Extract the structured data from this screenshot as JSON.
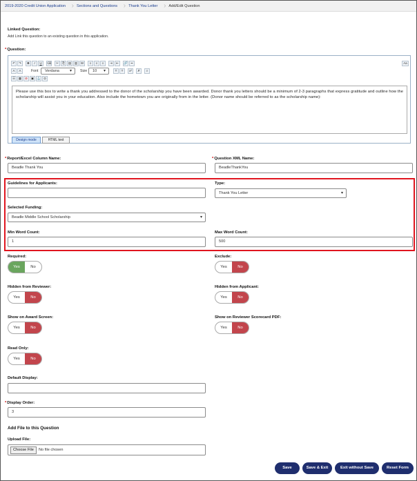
{
  "breadcrumb": [
    "2019-2020 Credit Union Application",
    "Sections and Questions",
    "Thank You Letter",
    "Add/Edit Question"
  ],
  "linked_question": {
    "label": "Linked Question:",
    "help": "Add Link this question to an existing question in this application."
  },
  "question": {
    "label": "Question:",
    "font_label": "Font",
    "font_value": "Verdana",
    "size_label": "Size",
    "size_value": "10",
    "aa_label": "Aa",
    "text": "Please use this box to write a thank you addressed to the donor of the scholarship you have been awarded. Donor thank you letters should be a minimum of 2-3 paragraphs that express gratitude and outline how the scholarship will assist you in your education. Also include the hometown you are originally from in the letter. (Donor name should be referred to as the scholarship name):",
    "design_mode": "Design mode",
    "html_text": "HTML text"
  },
  "toolbar_icons": [
    "undo-icon",
    "redo-icon",
    "bold-icon",
    "italic-icon",
    "underline-icon",
    "eraser-icon",
    "cut-icon",
    "copy-icon",
    "paste-icon",
    "paste-text-icon",
    "paste-word-icon",
    "align-left-icon",
    "align-center-icon",
    "align-right-icon",
    "indent-icon",
    "outdent-icon",
    "link-icon",
    "rule-icon"
  ],
  "report_column": {
    "label": "Report/Excel Column Name:",
    "value": "Beadle Thank You"
  },
  "question_xml": {
    "label": "Question XML Name:",
    "value": "BeadleThankYou"
  },
  "guidelines": {
    "label": "Guidelines for Applicants:",
    "value": ""
  },
  "type": {
    "label": "Type:",
    "value": "Thank You Letter"
  },
  "selected_funding": {
    "label": "Selected Funding:",
    "value": "Beadle Middle School Scholarship"
  },
  "min_word": {
    "label": "Min Word Count:",
    "value": "1"
  },
  "max_word": {
    "label": "Max Word Count:",
    "value": "500"
  },
  "toggles": {
    "yes": "Yes",
    "no": "No",
    "required": "Required:",
    "exclude": "Exclude:",
    "hidden_reviewer": "Hidden from Reviewer:",
    "hidden_applicant": "Hidden from Applicant:",
    "show_award": "Show on Award Screen:",
    "show_pdf": "Show on Reviewer Scorecard PDF:",
    "read_only": "Read Only:"
  },
  "default_display": {
    "label": "Default Display:",
    "value": ""
  },
  "display_order": {
    "label": "Display Order:",
    "value": "3"
  },
  "add_file": {
    "title": "Add File to this Question",
    "upload_label": "Upload File:",
    "choose": "Choose File",
    "no_file": "No file chosen"
  },
  "buttons": {
    "save": "Save",
    "save_exit": "Save & Exit",
    "exit_nosave": "Exit without Save",
    "reset": "Reset Form"
  },
  "colors": {
    "accent": "#1f2e6e",
    "yes_on": "#6aa55e",
    "no_on": "#c2454c",
    "highlight": "#e0141e"
  }
}
